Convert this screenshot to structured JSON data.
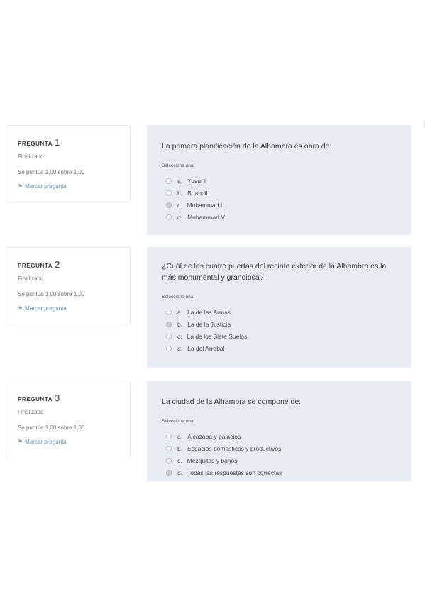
{
  "questions": [
    {
      "label": "PREGUNTA",
      "number": "1",
      "state": "Finalizado",
      "grade": "Se puntúa 1,00 sobre 1,00",
      "flag_icon": "flag-icon",
      "flag_label": "Marcar pregunta",
      "text": "La primera planificación de la Alhambra es obra de:",
      "prompt": "Seleccione una:",
      "selected": "c",
      "answers": [
        {
          "letter": "a.",
          "text": "Yusuf I"
        },
        {
          "letter": "b.",
          "text": "Boabdil"
        },
        {
          "letter": "c.",
          "text": "Muhammad I"
        },
        {
          "letter": "d.",
          "text": "Muhammad V"
        }
      ]
    },
    {
      "label": "PREGUNTA",
      "number": "2",
      "state": "Finalizado",
      "grade": "Se puntúa 1,00 sobre 1,00",
      "flag_icon": "flag-icon",
      "flag_label": "Marcar pregunta",
      "text": "¿Cuál de las cuatro puertas del recinto exterior de la Alhambra es la más monumental y grandiosa?",
      "prompt": "Seleccione una:",
      "selected": "b",
      "answers": [
        {
          "letter": "a.",
          "text": "La de las Armas"
        },
        {
          "letter": "b.",
          "text": "La de la Justicia"
        },
        {
          "letter": "c.",
          "text": "La de los Siete Suelos"
        },
        {
          "letter": "d.",
          "text": "La del Arrabal"
        }
      ]
    },
    {
      "label": "PREGUNTA",
      "number": "3",
      "state": "Finalizado",
      "grade": "Se puntúa 1,00 sobre 1,00",
      "flag_icon": "flag-icon",
      "flag_label": "Marcar pregunta",
      "text": "La ciudad de la Alhambra se compone de:",
      "prompt": "Seleccione una:",
      "selected": "d",
      "answers": [
        {
          "letter": "a.",
          "text": "Alcazaba y palacios"
        },
        {
          "letter": "b.",
          "text": "Espacios domésticos y productivos."
        },
        {
          "letter": "c.",
          "text": "Mezquitas y baños"
        },
        {
          "letter": "d.",
          "text": "Todas las respuestas son correctas"
        }
      ]
    }
  ]
}
